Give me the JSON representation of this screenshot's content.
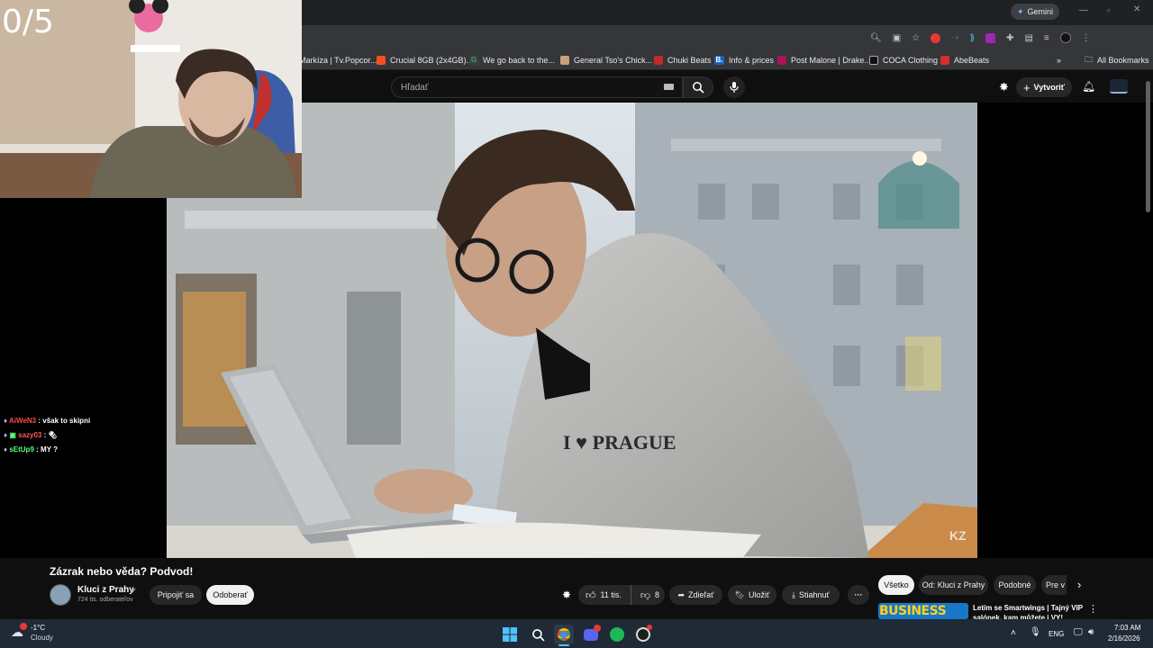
{
  "overlay": {
    "counter": "0/5"
  },
  "browser": {
    "gemini_label": "Gemini",
    "bookmarks": [
      {
        "label": "Markíza | Tv.Popcor...",
        "icon": "",
        "color": "#35363a"
      },
      {
        "label": "Crucial 8GB (2x4GB)...",
        "icon": "",
        "color": "#f4511e"
      },
      {
        "label": "We go back to the...",
        "icon": "G",
        "color": "#34a853"
      },
      {
        "label": "General Tso's Chick...",
        "icon": "",
        "color": "#c6a27a"
      },
      {
        "label": "Chuki Beats",
        "icon": "",
        "color": "#c62828"
      },
      {
        "label": "Info & prices",
        "icon": "B.",
        "color": "#1565c0"
      },
      {
        "label": "Post Malone | Drake...",
        "icon": "",
        "color": "#ad1457"
      },
      {
        "label": "COCA Clothing",
        "icon": "",
        "color": "#111111"
      },
      {
        "label": "AbeBeats",
        "icon": "",
        "color": "#d32f2f"
      }
    ],
    "all_bookmarks": "All Bookmarks"
  },
  "youtube": {
    "search_placeholder": "Hľadať",
    "create_label": "Vytvoriť",
    "video_title": "Zázrak nebo věda? Podvod!",
    "channel_name": "Kluci z Prahy",
    "subscribers": "724 tis. odberateľov",
    "join_label": "Pripojiť sa",
    "subscribe_label": "Odoberať",
    "likes": "11 tis.",
    "dislikes": "8",
    "share_label": "Zdieľať",
    "save_label": "Uložiť",
    "download_label": "Stiahnuť",
    "chips": [
      "Všetko",
      "Od: Kluci z Prahy",
      "Podobné",
      "Pre v"
    ],
    "rec_title": "Letím se Smartwings | Tajný VIP salónek, kam můžete i VY!",
    "rec_thumb_text": "BUSINESS",
    "watermark": "KZ"
  },
  "video_scene": {
    "shirt_text": "I ♥ PRAGUE"
  },
  "chat": [
    {
      "user": "AiWeN3",
      "msg": "však to skipni",
      "color": "#ff4b4b"
    },
    {
      "user": "sazy03",
      "msg": "",
      "color": "#ff5a5a"
    },
    {
      "user": "sEtUp9",
      "msg": "MY ?",
      "color": "#58ff7a"
    }
  ],
  "taskbar": {
    "weather_temp": "-1°C",
    "weather_desc": "Cloudy",
    "lang": "ENG",
    "time": "7:03 AM",
    "date": "2/16/2026"
  }
}
